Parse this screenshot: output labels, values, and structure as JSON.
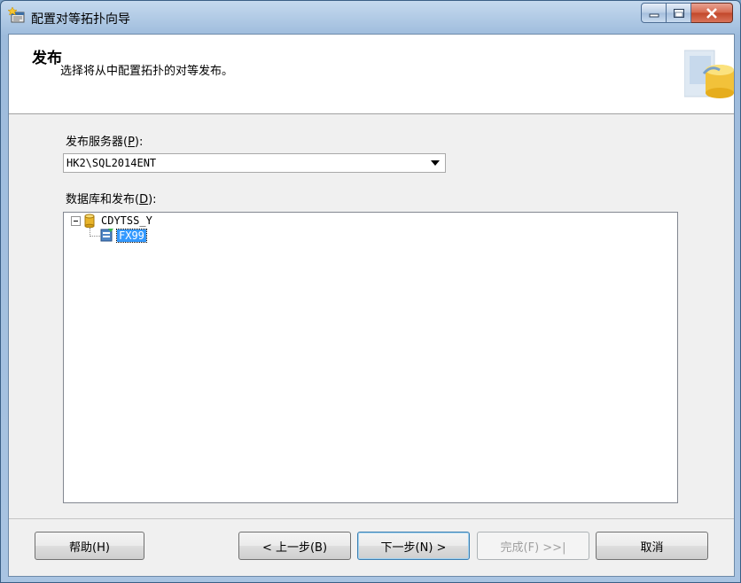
{
  "window": {
    "title": "配置对等拓扑向导"
  },
  "header": {
    "title": "发布",
    "subtitle": "选择将从中配置拓扑的对等发布。"
  },
  "publisher": {
    "label_pre": "发布服务器(",
    "label_key": "P",
    "label_post": "):",
    "value": "HK2\\SQL2014ENT"
  },
  "databases": {
    "label_pre": "数据库和发布(",
    "label_key": "D",
    "label_post": "):",
    "tree": {
      "database": "CDYTSS_Y",
      "publication": "FX99"
    }
  },
  "buttons": {
    "help": "帮助(H)",
    "back": "< 上一步(B)",
    "next": "下一步(N) >",
    "finish": "完成(F) >>|",
    "cancel": "取消"
  },
  "icons": {
    "app": "wizard-icon",
    "database": "database-icon",
    "publication": "publication-icon",
    "header": "database-banner-icon"
  },
  "colors": {
    "selection": "#3399ff",
    "close_button": "#c2472a"
  }
}
